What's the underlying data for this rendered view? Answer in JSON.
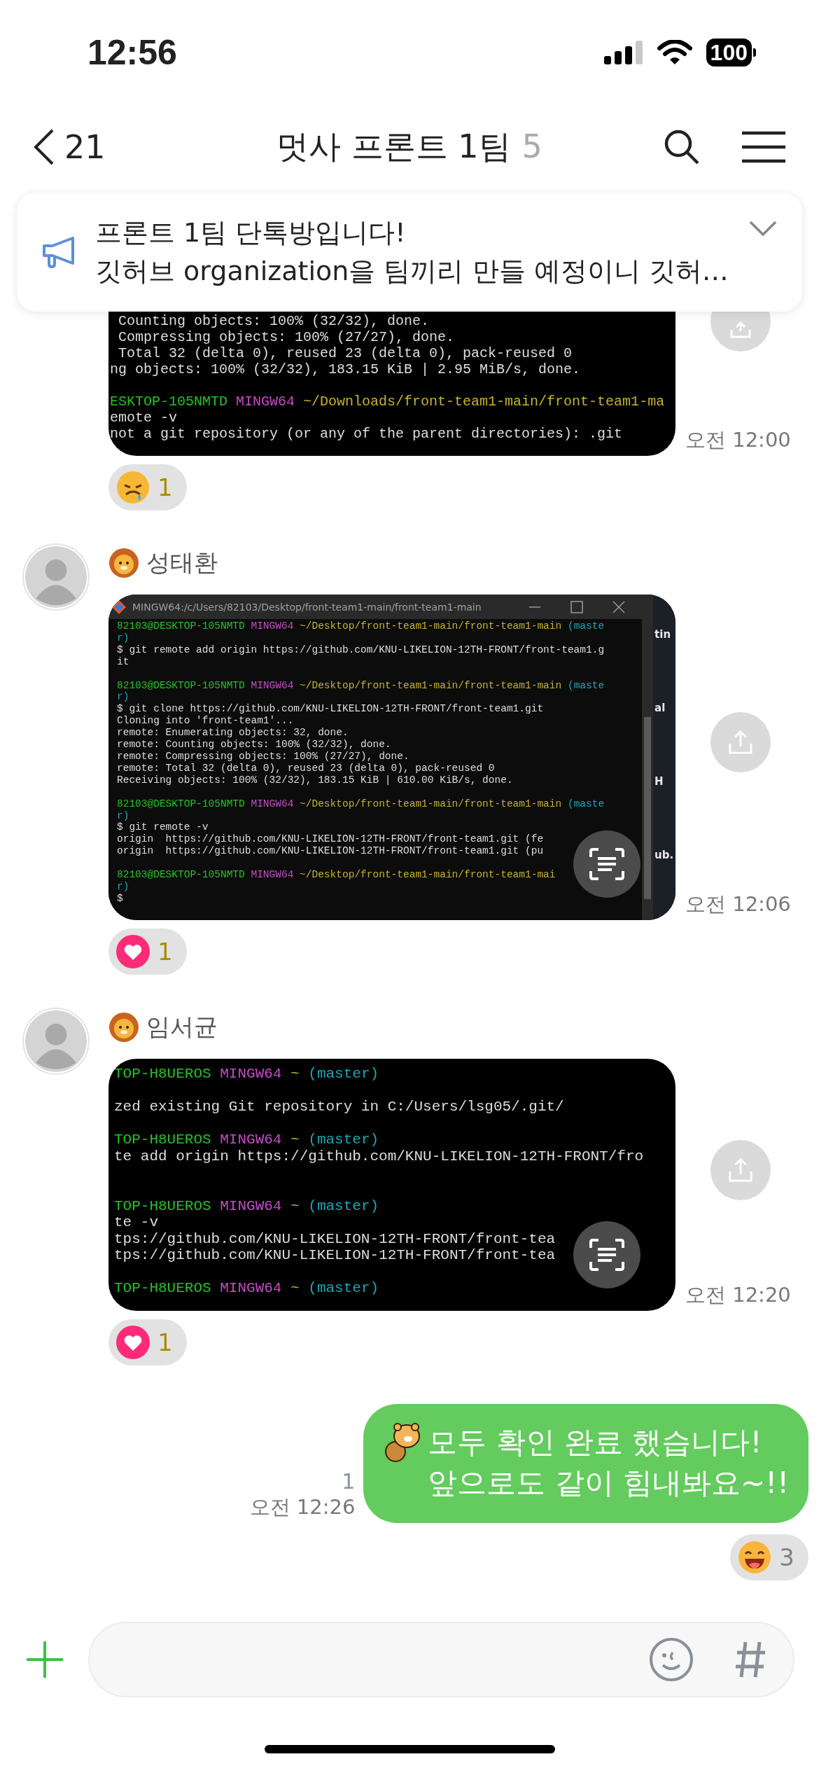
{
  "status_bar": {
    "time": "12:56",
    "battery": "100"
  },
  "header": {
    "back_count": "21",
    "title": "멋사 프론트 1팀",
    "member_count": "5"
  },
  "notice": {
    "title": "프론트 1팀 단톡방입니다!",
    "body": "깃허브 organization을 팀끼리 만들 예정이니 깃허…"
  },
  "messages": [
    {
      "kind": "image",
      "time": "오전 12:00",
      "reaction": {
        "kind": "sad",
        "count": "1",
        "mine": true
      },
      "terminal": {
        "lines": [
          {
            "kind": "text",
            "spans": [
              {
                "kind": "plain",
                "text": " Counting objects: 100% (32/32), done."
              }
            ]
          },
          {
            "kind": "text",
            "spans": [
              {
                "kind": "plain",
                "text": " Compressing objects: 100% (27/27), done."
              }
            ]
          },
          {
            "kind": "text",
            "spans": [
              {
                "kind": "plain",
                "text": " Total 32 (delta 0), reused 23 (delta 0), pack-reused 0"
              }
            ]
          },
          {
            "kind": "text",
            "spans": [
              {
                "kind": "plain",
                "text": "ng objects: 100% (32/32), 183.15 KiB | 2.95 MiB/s, done."
              }
            ]
          },
          {
            "kind": "blank"
          },
          {
            "kind": "text",
            "spans": [
              {
                "kind": "host",
                "text": "ESKTOP-105NMTD "
              },
              {
                "kind": "shell",
                "text": "MINGW64 "
              },
              {
                "kind": "path",
                "text": "~/Downloads/front-team1-main/front-team1-ma"
              }
            ]
          },
          {
            "kind": "text",
            "spans": [
              {
                "kind": "plain",
                "text": "emote -v"
              }
            ]
          },
          {
            "kind": "text",
            "spans": [
              {
                "kind": "plain",
                "text": "not a git repository (or any of the parent directories): .git"
              }
            ]
          }
        ]
      }
    },
    {
      "kind": "image",
      "sender": "성태환",
      "time": "오전 12:06",
      "reaction": {
        "kind": "heart",
        "count": "1",
        "mine": true
      },
      "terminal": {
        "window_title": "MINGW64:/c/Users/82103/Desktop/front-team1-main/front-team1-main",
        "side_texts": [
          "tin",
          "al",
          "H",
          "ub."
        ],
        "lines": [
          {
            "kind": "text",
            "spans": [
              {
                "kind": "host",
                "text": "82103@DESKTOP-105NMTD "
              },
              {
                "kind": "shell",
                "text": "MINGW64 "
              },
              {
                "kind": "path",
                "text": "~/Desktop/front-team1-main/front-team1-main "
              },
              {
                "kind": "branch",
                "text": "(maste"
              }
            ]
          },
          {
            "kind": "text",
            "spans": [
              {
                "kind": "branch",
                "text": "r)"
              }
            ]
          },
          {
            "kind": "text",
            "spans": [
              {
                "kind": "plain",
                "text": "$ git remote add origin https://github.com/KNU-LIKELION-12TH-FRONT/front-team1.g"
              }
            ]
          },
          {
            "kind": "text",
            "spans": [
              {
                "kind": "plain",
                "text": "it"
              }
            ]
          },
          {
            "kind": "blank"
          },
          {
            "kind": "text",
            "spans": [
              {
                "kind": "host",
                "text": "82103@DESKTOP-105NMTD "
              },
              {
                "kind": "shell",
                "text": "MINGW64 "
              },
              {
                "kind": "path",
                "text": "~/Desktop/front-team1-main/front-team1-main "
              },
              {
                "kind": "branch",
                "text": "(maste"
              }
            ]
          },
          {
            "kind": "text",
            "spans": [
              {
                "kind": "branch",
                "text": "r)"
              }
            ]
          },
          {
            "kind": "text",
            "spans": [
              {
                "kind": "plain",
                "text": "$ git clone https://github.com/KNU-LIKELION-12TH-FRONT/front-team1.git"
              }
            ]
          },
          {
            "kind": "text",
            "spans": [
              {
                "kind": "plain",
                "text": "Cloning into 'front-team1'..."
              }
            ]
          },
          {
            "kind": "text",
            "spans": [
              {
                "kind": "plain",
                "text": "remote: Enumerating objects: 32, done."
              }
            ]
          },
          {
            "kind": "text",
            "spans": [
              {
                "kind": "plain",
                "text": "remote: Counting objects: 100% (32/32), done."
              }
            ]
          },
          {
            "kind": "text",
            "spans": [
              {
                "kind": "plain",
                "text": "remote: Compressing objects: 100% (27/27), done."
              }
            ]
          },
          {
            "kind": "text",
            "spans": [
              {
                "kind": "plain",
                "text": "remote: Total 32 (delta 0), reused 23 (delta 0), pack-reused 0"
              }
            ]
          },
          {
            "kind": "text",
            "spans": [
              {
                "kind": "plain",
                "text": "Receiving objects: 100% (32/32), 183.15 KiB | 610.00 KiB/s, done."
              }
            ]
          },
          {
            "kind": "blank"
          },
          {
            "kind": "text",
            "spans": [
              {
                "kind": "host",
                "text": "82103@DESKTOP-105NMTD "
              },
              {
                "kind": "shell",
                "text": "MINGW64 "
              },
              {
                "kind": "path",
                "text": "~/Desktop/front-team1-main/front-team1-main "
              },
              {
                "kind": "branch",
                "text": "(maste"
              }
            ]
          },
          {
            "kind": "text",
            "spans": [
              {
                "kind": "branch",
                "text": "r)"
              }
            ]
          },
          {
            "kind": "text",
            "spans": [
              {
                "kind": "plain",
                "text": "$ git remote -v"
              }
            ]
          },
          {
            "kind": "text",
            "spans": [
              {
                "kind": "plain",
                "text": "origin  https://github.com/KNU-LIKELION-12TH-FRONT/front-team1.git (fe"
              }
            ]
          },
          {
            "kind": "text",
            "spans": [
              {
                "kind": "plain",
                "text": "origin  https://github.com/KNU-LIKELION-12TH-FRONT/front-team1.git (pu"
              }
            ]
          },
          {
            "kind": "blank"
          },
          {
            "kind": "text",
            "spans": [
              {
                "kind": "host",
                "text": "82103@DESKTOP-105NMTD "
              },
              {
                "kind": "shell",
                "text": "MINGW64 "
              },
              {
                "kind": "path",
                "text": "~/Desktop/front-team1-main/front-team1-mai"
              }
            ]
          },
          {
            "kind": "text",
            "spans": [
              {
                "kind": "branch",
                "text": "r)"
              }
            ]
          },
          {
            "kind": "text",
            "spans": [
              {
                "kind": "plain",
                "text": "$"
              }
            ]
          }
        ]
      }
    },
    {
      "kind": "image",
      "sender": "임서균",
      "time": "오전 12:20",
      "reaction": {
        "kind": "heart",
        "count": "1",
        "mine": true
      },
      "terminal": {
        "lines": [
          {
            "kind": "text",
            "spans": [
              {
                "kind": "host",
                "text": "TOP-H8UEROS "
              },
              {
                "kind": "shell",
                "text": "MINGW64 "
              },
              {
                "kind": "path",
                "text": "~ "
              },
              {
                "kind": "branch",
                "text": "(master)"
              }
            ]
          },
          {
            "kind": "blank"
          },
          {
            "kind": "text",
            "spans": [
              {
                "kind": "plain",
                "text": "zed existing Git repository in C:/Users/lsg05/.git/"
              }
            ]
          },
          {
            "kind": "blank"
          },
          {
            "kind": "text",
            "spans": [
              {
                "kind": "host",
                "text": "TOP-H8UEROS "
              },
              {
                "kind": "shell",
                "text": "MINGW64 "
              },
              {
                "kind": "path",
                "text": "~ "
              },
              {
                "kind": "branch",
                "text": "(master)"
              }
            ]
          },
          {
            "kind": "text",
            "spans": [
              {
                "kind": "plain",
                "text": "te add origin https://github.com/KNU-LIKELION-12TH-FRONT/fro"
              }
            ]
          },
          {
            "kind": "blank"
          },
          {
            "kind": "blank"
          },
          {
            "kind": "text",
            "spans": [
              {
                "kind": "host",
                "text": "TOP-H8UEROS "
              },
              {
                "kind": "shell",
                "text": "MINGW64 "
              },
              {
                "kind": "path",
                "text": "~ "
              },
              {
                "kind": "branch",
                "text": "(master)"
              }
            ]
          },
          {
            "kind": "text",
            "spans": [
              {
                "kind": "plain",
                "text": "te -v"
              }
            ]
          },
          {
            "kind": "text",
            "spans": [
              {
                "kind": "plain",
                "text": "tps://github.com/KNU-LIKELION-12TH-FRONT/front-tea"
              }
            ]
          },
          {
            "kind": "text",
            "spans": [
              {
                "kind": "plain",
                "text": "tps://github.com/KNU-LIKELION-12TH-FRONT/front-tea"
              }
            ]
          },
          {
            "kind": "blank"
          },
          {
            "kind": "text",
            "spans": [
              {
                "kind": "host",
                "text": "TOP-H8UEROS "
              },
              {
                "kind": "shell",
                "text": "MINGW64 "
              },
              {
                "kind": "path",
                "text": "~ "
              },
              {
                "kind": "branch",
                "text": "(master)"
              }
            ]
          }
        ]
      }
    },
    {
      "kind": "text",
      "mine": true,
      "read_count": "1",
      "time": "오전 12:26",
      "text": "모두 확인 완료 했습니다!\n앞으로도 같이 힘내봐요~!!",
      "reaction": {
        "kind": "grin",
        "count": "3",
        "mine": false
      }
    }
  ]
}
